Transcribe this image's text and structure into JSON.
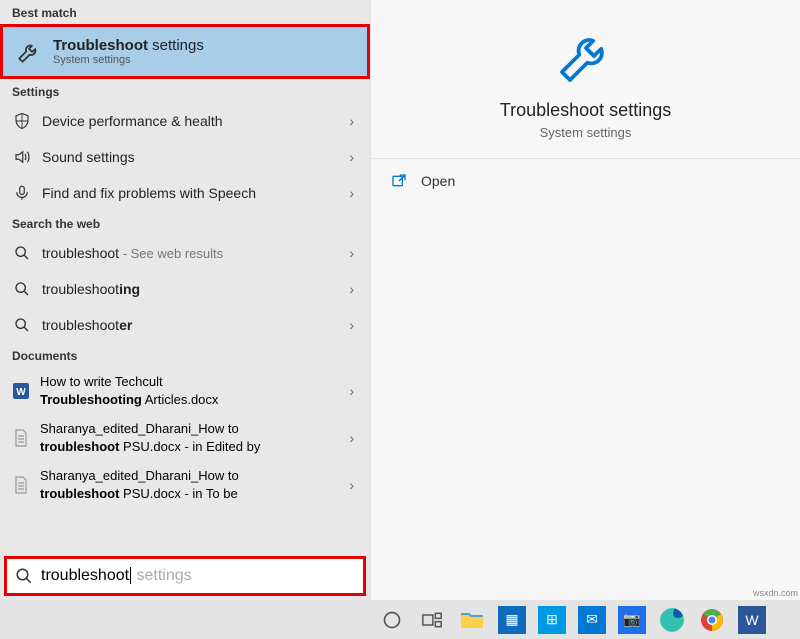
{
  "sections": {
    "best_match": "Best match",
    "settings": "Settings",
    "web": "Search the web",
    "documents": "Documents"
  },
  "best_match_item": {
    "title_bold": "Troubleshoot",
    "title_rest": " settings",
    "subtitle": "System settings"
  },
  "settings_items": [
    {
      "label": "Device performance & health"
    },
    {
      "label": "Sound settings"
    },
    {
      "label": "Find and fix problems with Speech"
    }
  ],
  "web_items": [
    {
      "prefix": "troubleshoot",
      "bold": "",
      "suffix": " - See web results"
    },
    {
      "prefix": "troubleshoot",
      "bold": "ing",
      "suffix": ""
    },
    {
      "prefix": "troubleshoot",
      "bold": "er",
      "suffix": ""
    }
  ],
  "documents_items": [
    {
      "line1": "How to write Techcult",
      "line2_bold": "Troubleshooting",
      "line2_rest": " Articles.docx",
      "meta": "",
      "type": "word"
    },
    {
      "line1": "Sharanya_edited_Dharani_How to",
      "line2_bold": "troubleshoot",
      "line2_rest": " PSU.docx",
      "meta": " - in Edited by",
      "type": "generic"
    },
    {
      "line1": "Sharanya_edited_Dharani_How to",
      "line2_bold": "troubleshoot",
      "line2_rest": " PSU.docx",
      "meta": " - in To be",
      "type": "generic"
    }
  ],
  "search": {
    "typed": "troubleshoot",
    "hint": " settings"
  },
  "preview": {
    "title": "Troubleshoot settings",
    "subtitle": "System settings",
    "open": "Open"
  },
  "watermark": "wsxdn.com"
}
